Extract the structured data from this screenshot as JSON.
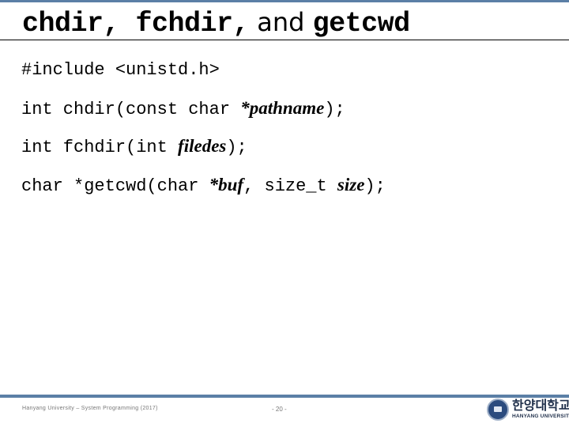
{
  "slide": {
    "title": {
      "part1": "chdir, fchdir,",
      "part2": " and ",
      "part3": "getcwd"
    },
    "code_lines": [
      {
        "segments": [
          {
            "text": "#include <unistd.h>",
            "style": "mono"
          }
        ]
      },
      {
        "segments": [
          {
            "text": "int chdir(const char ",
            "style": "mono"
          },
          {
            "text": "*pathname",
            "style": "param"
          },
          {
            "text": ");",
            "style": "mono"
          }
        ]
      },
      {
        "segments": [
          {
            "text": "int fchdir(int ",
            "style": "mono"
          },
          {
            "text": "filedes",
            "style": "param"
          },
          {
            "text": ");",
            "style": "mono"
          }
        ]
      },
      {
        "segments": [
          {
            "text": "char *getcwd(char ",
            "style": "mono"
          },
          {
            "text": "*buf",
            "style": "param"
          },
          {
            "text": ", size_t ",
            "style": "mono"
          },
          {
            "text": "size",
            "style": "param"
          },
          {
            "text": ");",
            "style": "mono"
          }
        ]
      }
    ]
  },
  "footer": {
    "left_text": "Hanyang University – System Programming (2017)",
    "page_number": "- 20 -",
    "logo": {
      "korean": "한양대학교",
      "english": "HANYANG UNIVERSITY",
      "icon": "university-seal-icon"
    }
  },
  "colors": {
    "accent_bar": "#5b7fa6",
    "text": "#000000",
    "footer_text": "#777777"
  }
}
